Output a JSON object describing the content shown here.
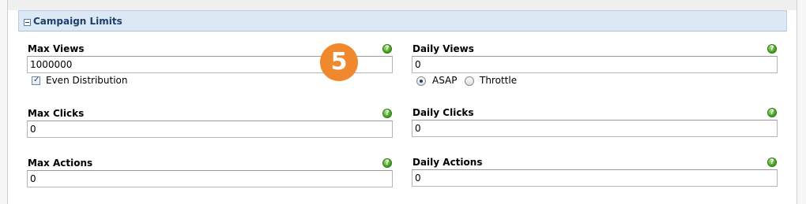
{
  "section": {
    "title": "Campaign Limits"
  },
  "fields": {
    "max_views": {
      "label": "Max Views",
      "value": "1000000"
    },
    "daily_views": {
      "label": "Daily Views",
      "value": "0"
    },
    "max_clicks": {
      "label": "Max Clicks",
      "value": "0"
    },
    "daily_clicks": {
      "label": "Daily Clicks",
      "value": "0"
    },
    "max_actions": {
      "label": "Max Actions",
      "value": "0"
    },
    "daily_actions": {
      "label": "Daily Actions",
      "value": "0"
    }
  },
  "even_distribution": {
    "label": "Even Distribution",
    "checked": true
  },
  "pacing": {
    "asap_label": "ASAP",
    "throttle_label": "Throttle",
    "selected": "ASAP"
  },
  "help_icon_glyph": "?",
  "help_icon_color": "#4fab2c",
  "badge": {
    "text": "5",
    "color": "#f0882e"
  },
  "colors": {
    "header_bg": "#dce9f4",
    "header_text": "#1f3f6b"
  }
}
